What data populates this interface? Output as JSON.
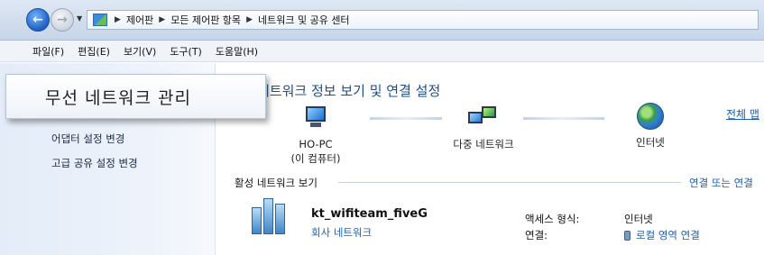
{
  "address_bar": {
    "breadcrumbs": [
      "제어판",
      "모든 제어판 항목",
      "네트워크 및 공유 센터"
    ]
  },
  "menu": [
    "파일(F)",
    "편집(E)",
    "보기(V)",
    "도구(T)",
    "도움말(H)"
  ],
  "left_pane": {
    "links": [
      "어댑터 설정 변경",
      "고급 공유 설정 변경"
    ]
  },
  "tooltip": {
    "text": "무선 네트워크 관리"
  },
  "main": {
    "heading": "네트워크 정보 보기 및 연결 설정",
    "full_map_link": "전체 맵",
    "map": {
      "this_pc_name": "HO-PC",
      "this_pc_sub": "(이 컴퓨터)",
      "multi_network": "다중 네트워크",
      "internet": "인터넷"
    },
    "active_section": {
      "title": "활성 네트워크 보기",
      "connect_link": "연결 또는 연결",
      "network_name": "kt_wifiteam_fiveG",
      "network_type": "회사 네트워크",
      "access_label": "액세스 형식:",
      "access_value": "인터넷",
      "connection_label": "연결:",
      "connection_value": "로컬 영역 연결"
    }
  },
  "icons": [
    "back-arrow-icon",
    "forward-arrow-icon",
    "control-panel-icon",
    "computer-icon",
    "multi-network-icon",
    "globe-icon",
    "network-bench-icon",
    "lan-connection-icon"
  ],
  "colors": {
    "link": "#1a5fb4",
    "heading": "#1e4f8c",
    "left_pane": "#e3ecf8"
  }
}
